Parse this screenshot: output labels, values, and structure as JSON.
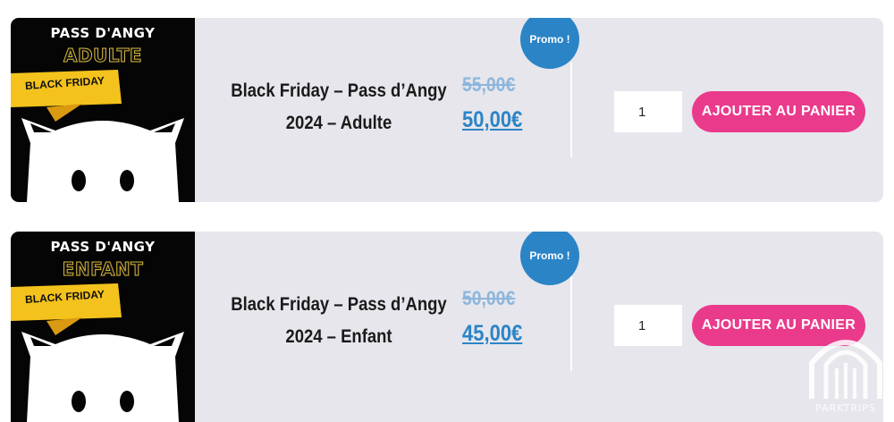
{
  "products": [
    {
      "thumb_title": "PASS D'ANGY",
      "thumb_sub": "ADULTE",
      "ribbon": "BLACK FRIDAY",
      "name_line1": "Black Friday – Pass d’Angy",
      "name_line2": "2024 – Adulte",
      "old_price": "55,00€",
      "new_price": "50,00€",
      "badge": "Promo !",
      "quantity": "1",
      "button": "AJOUTER AU PANIER"
    },
    {
      "thumb_title": "PASS D'ANGY",
      "thumb_sub": "ENFANT",
      "ribbon": "BLACK FRIDAY",
      "name_line1": "Black Friday – Pass d’Angy",
      "name_line2": "2024 – Enfant",
      "old_price": "50,00€",
      "new_price": "45,00€",
      "badge": "Promo !",
      "quantity": "1",
      "button": "AJOUTER AU PANIER"
    }
  ],
  "watermark": "PARKTRIPS",
  "colors": {
    "card_bg": "#e6e6ec",
    "accent_blue": "#2b84c6",
    "button_pink": "#ea3a8b",
    "ribbon_yellow": "#f4c21c"
  }
}
